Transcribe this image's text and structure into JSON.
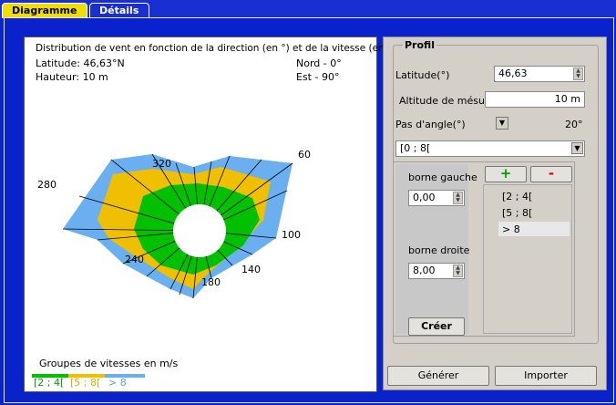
{
  "tabs": [
    {
      "label": "Diagramme",
      "active": true
    },
    {
      "label": "Détails",
      "active": false
    }
  ],
  "chart": {
    "title": "Distribution de vent en fonction de la direction (en °) et de la vitesse (en m/s)",
    "latitude_line": "Latitude: 46,63°N",
    "hauteur_line": "Hauteur: 10 m",
    "nord_line": "Nord - 0°",
    "est_line": "Est - 90°",
    "angle_labels": [
      "320",
      "60",
      "280",
      "100",
      "240",
      "140",
      "180"
    ],
    "legend_title": "Groupes de vitesses en m/s",
    "legend_items": [
      {
        "label": "[2 ; 4[",
        "color": "#00c000"
      },
      {
        "label": "[5 ; 8[",
        "color": "#f0c000"
      },
      {
        "label": "> 8",
        "color": "#6ab0f0"
      }
    ]
  },
  "chart_data": {
    "type": "polar-stacked",
    "title": "Distribution de vent en fonction de la direction (en °) et de la vitesse (en m/s)",
    "series": [
      {
        "name": "[2 ; 4[",
        "color": "#00c000"
      },
      {
        "name": "[5 ; 8[",
        "color": "#f0c000"
      },
      {
        "name": "> 8",
        "color": "#6ab0f0"
      }
    ],
    "angle_step": 20,
    "tick_labels": [
      "60",
      "100",
      "140",
      "180",
      "240",
      "280",
      "320"
    ]
  },
  "panel": {
    "group_title": "Profil",
    "latitude_label": "Latitude(°)",
    "latitude_value": "46,63",
    "altitude_label": "Altitude de mésure",
    "altitude_value": "10 m",
    "pas_label": "Pas d'angle(°)",
    "pas_value": "20°",
    "range_select": "[0 ; 8[",
    "borne_gauche_label": "borne gauche",
    "borne_gauche_value": "0,00",
    "borne_droite_label": "borne droite",
    "borne_droite_value": "8,00",
    "creer_label": "Créer",
    "plus_label": "+",
    "minus_label": "-",
    "ranges": [
      "[2 ; 4[",
      "[5 ; 8[",
      "> 8"
    ],
    "generer_label": "Générer",
    "importer_label": "Importer"
  }
}
